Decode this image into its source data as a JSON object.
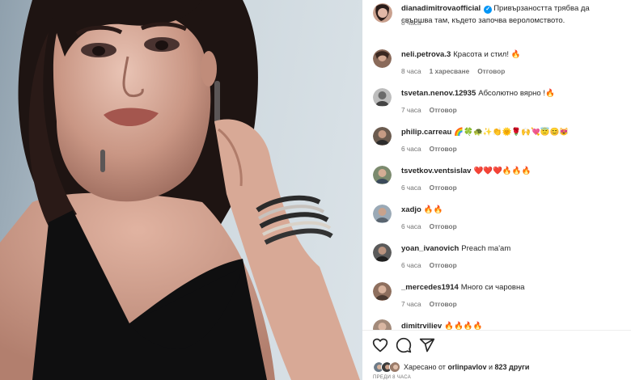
{
  "post": {
    "author": "dianadimitrovaofficial",
    "caption": "Привързаността трябва да свършва там, където започва вероломството.",
    "time": "8 часа"
  },
  "comments": [
    {
      "username": "neli.petrova.3",
      "text": "Красота и стил! 🔥",
      "time": "8 часа",
      "likes": "1 харесване",
      "reply": "Отговор"
    },
    {
      "username": "tsvetan.nenov.12935",
      "text": "Абсолютно вярно !🔥",
      "time": "7 часа",
      "likes": "",
      "reply": "Отговор"
    },
    {
      "username": "philip.carreau",
      "text": "🌈🍀🐢✨👏🌞🌹🙌💘😇😊😻",
      "time": "6 часа",
      "likes": "",
      "reply": "Отговор"
    },
    {
      "username": "tsvetkov.ventsislav",
      "text": "❤️❤️❤️🔥🔥🔥",
      "time": "6 часа",
      "likes": "",
      "reply": "Отговор"
    },
    {
      "username": "xadjo",
      "text": "🔥🔥",
      "time": "6 часа",
      "likes": "",
      "reply": "Отговор"
    },
    {
      "username": "yoan_ivanovich",
      "text": "Preach ma'am",
      "time": "6 часа",
      "likes": "",
      "reply": "Отговор"
    },
    {
      "username": "_mercedes1914",
      "text": "Много си чаровна",
      "time": "7 часа",
      "likes": "",
      "reply": "Отговор"
    },
    {
      "username": "dimitrviliev",
      "text": "🔥🔥🔥🔥",
      "time": "",
      "likes": "",
      "reply": ""
    }
  ],
  "likes": {
    "prefix": "Харесано от",
    "liker": "orlinpavlov",
    "middle": "и",
    "others": "823 други"
  },
  "posted_ago": "ПРЕДИ 8 ЧАСА",
  "icons": [
    "heart-icon",
    "comment-icon",
    "share-icon"
  ],
  "colors": {
    "verified": "#0095f6",
    "meta": "#737373",
    "text": "#262626"
  }
}
